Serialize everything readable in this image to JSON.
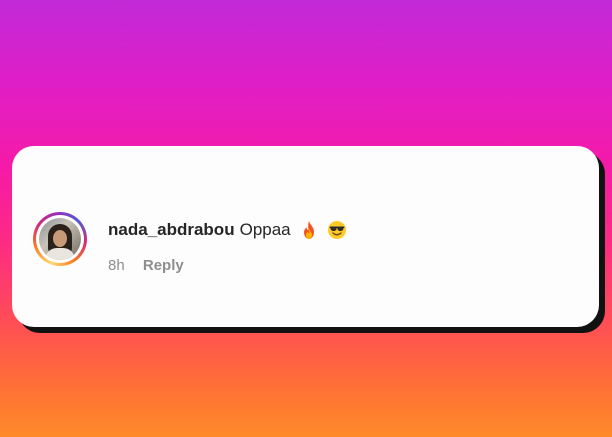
{
  "comment": {
    "username": "nada_abdrabou",
    "text": "Oppaa",
    "emojis": [
      "fire-emoji",
      "smiling-face-with-sunglasses-emoji"
    ],
    "timestamp": "8h",
    "reply_label": "Reply"
  },
  "colors": {
    "background_gradient": [
      "#c22ad8",
      "#f51aa8",
      "#ff4a5a",
      "#ff8a28"
    ],
    "card": "#fdfdfd",
    "text_primary": "#262626",
    "text_secondary": "#8e8e8e"
  }
}
